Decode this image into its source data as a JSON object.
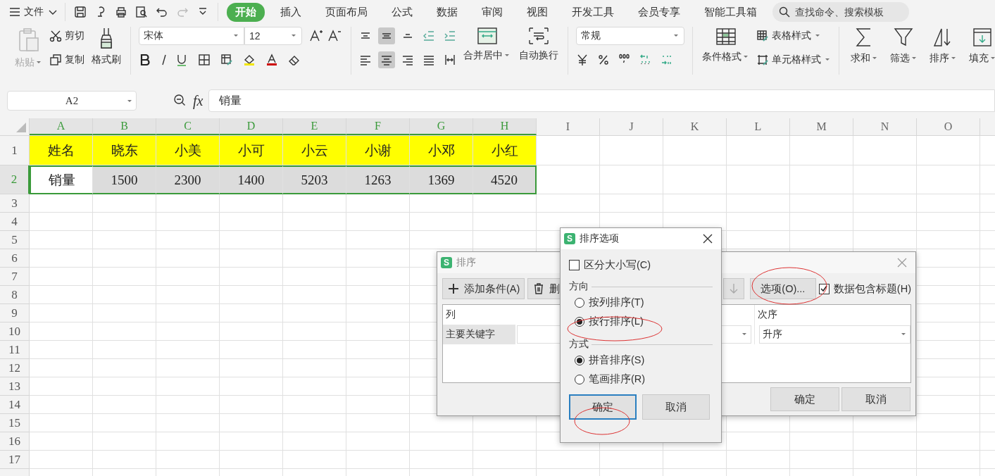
{
  "menu_bar": {
    "file_menu": "文件",
    "tabs": [
      {
        "label": "开始",
        "selected": true
      },
      {
        "label": "插入",
        "selected": false
      },
      {
        "label": "页面布局",
        "selected": false
      },
      {
        "label": "公式",
        "selected": false
      },
      {
        "label": "数据",
        "selected": false
      },
      {
        "label": "审阅",
        "selected": false
      },
      {
        "label": "视图",
        "selected": false
      },
      {
        "label": "开发工具",
        "selected": false
      },
      {
        "label": "会员专享",
        "selected": false
      },
      {
        "label": "智能工具箱",
        "selected": false
      }
    ],
    "search": {
      "placeholder": "查找命令、搜索模板"
    }
  },
  "ribbon": {
    "paste": "粘贴",
    "cut": "剪切",
    "copy": "复制",
    "format_painter": "格式刷",
    "font_name": "宋体",
    "font_size": "12",
    "vertical_align": [
      {
        "selected": false
      },
      {
        "selected": true
      },
      {
        "selected": false
      }
    ],
    "horizontal_align": [
      {
        "selected": false
      },
      {
        "selected": true
      },
      {
        "selected": false
      }
    ],
    "merge": "合并居中",
    "wrap": "自动换行",
    "number_format": "常规",
    "conditional_format": "条件格式",
    "table_style": "表格样式",
    "cell_style": "单元格样式",
    "editing": [
      "求和",
      "筛选",
      "排序",
      "填充"
    ]
  },
  "formula_bar": {
    "name_box": "A2",
    "function_label": "fx",
    "formula": "销量"
  },
  "sheet": {
    "columns": [
      {
        "label": "A",
        "selected": true
      },
      {
        "label": "B",
        "selected": true
      },
      {
        "label": "C",
        "selected": true
      },
      {
        "label": "D",
        "selected": true
      },
      {
        "label": "E",
        "selected": true
      },
      {
        "label": "F",
        "selected": true
      },
      {
        "label": "G",
        "selected": true
      },
      {
        "label": "H",
        "selected": true
      },
      {
        "label": "I",
        "selected": false
      },
      {
        "label": "J",
        "selected": false
      },
      {
        "label": "K",
        "selected": false
      },
      {
        "label": "L",
        "selected": false
      },
      {
        "label": "M",
        "selected": false
      },
      {
        "label": "N",
        "selected": false
      },
      {
        "label": "O",
        "selected": false
      }
    ],
    "rows": [
      {
        "label": "1",
        "selected": false,
        "highlighted": true,
        "cells": [
          "姓名",
          "晓东",
          "小美",
          "小可",
          "小云",
          "小谢",
          "小邓",
          "小红"
        ]
      },
      {
        "label": "2",
        "selected": true,
        "highlighted": false,
        "cells": [
          "销量",
          "1500",
          "2300",
          "1400",
          "5203",
          "1263",
          "1369",
          "4520"
        ]
      },
      {
        "label": "3",
        "selected": false
      },
      {
        "label": "4",
        "selected": false
      },
      {
        "label": "5",
        "selected": false
      },
      {
        "label": "6",
        "selected": false
      },
      {
        "label": "7",
        "selected": false
      },
      {
        "label": "8",
        "selected": false
      },
      {
        "label": "9",
        "selected": false
      },
      {
        "label": "10",
        "selected": false
      },
      {
        "label": "11",
        "selected": false
      },
      {
        "label": "12",
        "selected": false
      },
      {
        "label": "13",
        "selected": false
      },
      {
        "label": "14",
        "selected": false
      },
      {
        "label": "15",
        "selected": false
      },
      {
        "label": "16",
        "selected": false
      },
      {
        "label": "17",
        "selected": false
      }
    ]
  },
  "sort_dialog": {
    "logo": "S",
    "title": "排序",
    "add_button": "添加条件(A)",
    "delete_button": "删",
    "options_button": "选项(O)...",
    "header_checkbox": {
      "label": "数据包含标题(H)",
      "checked": true
    },
    "table": {
      "columns": [
        "列",
        "次序"
      ],
      "rows": [
        {
          "key": "主要关键字",
          "order": "升序"
        }
      ]
    },
    "buttons": [
      "确定",
      "取消"
    ]
  },
  "options_dialog": {
    "logo": "S",
    "title": "排序选项",
    "case_checkbox": {
      "label": "区分大小写(C)",
      "checked": false
    },
    "direction": {
      "title": "方向",
      "options": [
        {
          "label": "按列排序(T)",
          "selected": false
        },
        {
          "label": "按行排序(L)",
          "selected": true
        }
      ]
    },
    "method": {
      "title": "方式",
      "options": [
        {
          "label": "拼音排序(S)",
          "selected": true
        },
        {
          "label": "笔画排序(R)",
          "selected": false
        }
      ]
    },
    "buttons": [
      "确定",
      "取消"
    ]
  }
}
